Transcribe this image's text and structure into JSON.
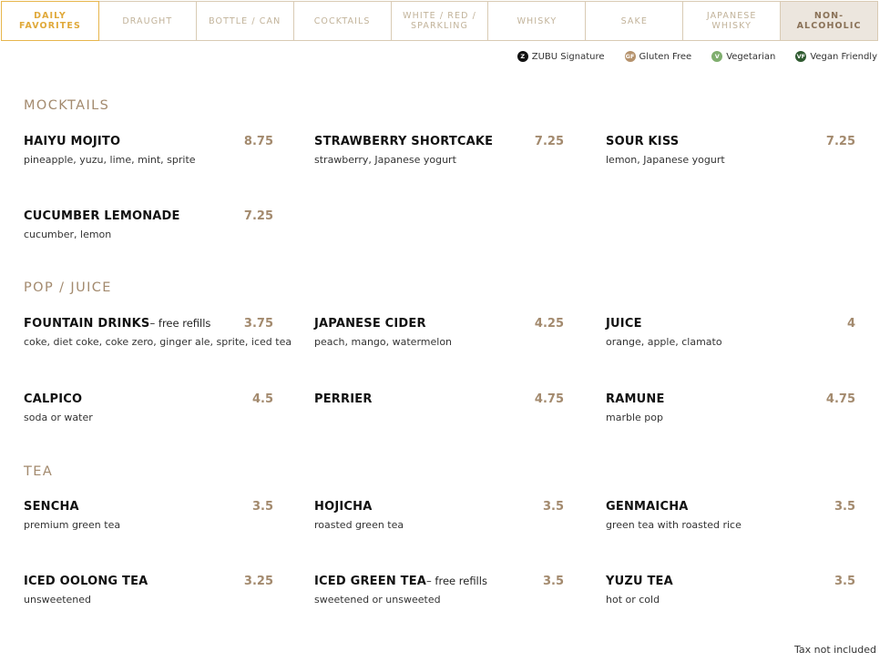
{
  "tabs": [
    {
      "label": "DAILY FAVORITES"
    },
    {
      "label": "DRAUGHT"
    },
    {
      "label": "BOTTLE / CAN"
    },
    {
      "label": "COCKTAILS"
    },
    {
      "label": "WHITE / RED / SPARKLING"
    },
    {
      "label": "WHISKY"
    },
    {
      "label": "SAKE"
    },
    {
      "label": "JAPANESE WHISKY"
    },
    {
      "label": "NON-ALCOHOLIC"
    }
  ],
  "legend": [
    {
      "badge": "Z",
      "label": "ZUBU Signature",
      "color": "#111111"
    },
    {
      "badge": "GF",
      "label": "Gluten Free",
      "color": "#b5926c"
    },
    {
      "badge": "V",
      "label": "Vegetarian",
      "color": "#7fae6e"
    },
    {
      "badge": "VF",
      "label": "Vegan Friendly",
      "color": "#2f5a30"
    }
  ],
  "sections": {
    "mocktails": {
      "title": "MOCKTAILS",
      "items": [
        {
          "name": "HAIYU MOJITO",
          "price": "8.75",
          "desc": "pineapple, yuzu, lime, mint, sprite"
        },
        {
          "name": "STRAWBERRY SHORTCAKE",
          "price": "7.25",
          "desc": "strawberry, Japanese yogurt"
        },
        {
          "name": "SOUR KISS",
          "price": "7.25",
          "desc": "lemon, Japanese yogurt"
        },
        {
          "name": "CUCUMBER LEMONADE",
          "price": "7.25",
          "desc": "cucumber, lemon"
        }
      ]
    },
    "pop": {
      "title": "POP / JUICE",
      "items": [
        {
          "name": "FOUNTAIN DRINKS",
          "note": "– free refills",
          "price": "3.75",
          "desc": "coke, diet coke, coke zero, ginger ale, sprite, iced tea"
        },
        {
          "name": "JAPANESE CIDER",
          "price": "4.25",
          "desc": "peach, mango, watermelon"
        },
        {
          "name": "JUICE",
          "price": "4",
          "desc": "orange, apple, clamato"
        },
        {
          "name": "CALPICO",
          "price": "4.5",
          "desc": "soda or water"
        },
        {
          "name": "PERRIER",
          "price": "4.75",
          "desc": ""
        },
        {
          "name": "RAMUNE",
          "price": "4.75",
          "desc": "marble pop"
        }
      ]
    },
    "tea": {
      "title": "TEA",
      "items": [
        {
          "name": "SENCHA",
          "price": "3.5",
          "desc": "premium green tea"
        },
        {
          "name": "HOJICHA",
          "price": "3.5",
          "desc": "roasted green tea"
        },
        {
          "name": "GENMAICHA",
          "price": "3.5",
          "desc": "green tea with roasted rice"
        },
        {
          "name": "ICED OOLONG TEA",
          "price": "3.25",
          "desc": "unsweetened"
        },
        {
          "name": "ICED GREEN TEA",
          "note": "– free refills",
          "price": "3.5",
          "desc": "sweetened or unsweeted"
        },
        {
          "name": "YUZU TEA",
          "price": "3.5",
          "desc": "hot or cold"
        }
      ]
    }
  },
  "footer": {
    "tax_note": "Tax not included"
  }
}
